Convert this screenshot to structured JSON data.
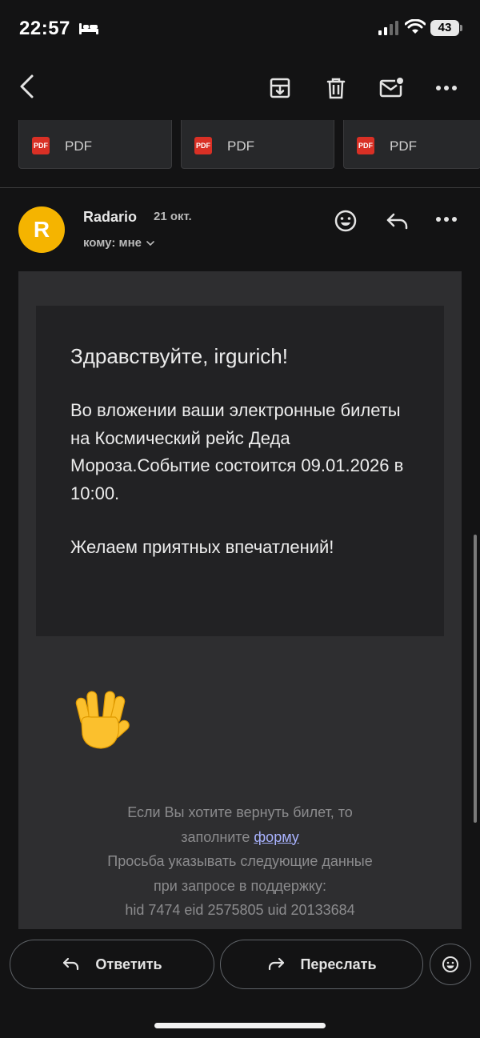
{
  "status_bar": {
    "time": "22:57",
    "battery": "43"
  },
  "attachments": [
    {
      "type_label": "PDF",
      "badge": "PDF"
    },
    {
      "type_label": "PDF",
      "badge": "PDF"
    },
    {
      "type_label": "PDF",
      "badge": "PDF"
    }
  ],
  "sender": {
    "initial": "R",
    "name": "Radario",
    "date": "21 окт.",
    "recipient": "кому: мне",
    "avatar_color": "#f5b400"
  },
  "email": {
    "greeting": "Здравствуйте, irgurich!",
    "main_text": "Во вложении ваши электронные билеты на Космический рейс Деда Мороза.Событие состоится 09.01.2026 в 10:00.",
    "wish": "Желаем приятных впечатлений!",
    "emoji": "raised-hand-vulcan-icon",
    "footer": {
      "line1": "Если Вы хотите вернуть билет, то",
      "line2_prefix": "заполните ",
      "link_text": "форму",
      "line3": "Просьба указывать следующие данные",
      "line4": "при запросе в поддержку:",
      "line5": "hid 7474 eid 2575805 uid 20133684"
    }
  },
  "actions": {
    "reply_label": "Ответить",
    "forward_label": "Переслать"
  },
  "icons": {
    "back": "chevron-left-icon",
    "archive": "archive-icon",
    "delete": "trash-icon",
    "mark_unread": "mail-unread-icon",
    "more": "more-horizontal-icon",
    "add_reaction": "emoji-smile-icon",
    "reply": "reply-icon",
    "forward": "forward-icon"
  },
  "colors": {
    "pdf_red": "#d93025",
    "link": "#a9b3ff"
  }
}
